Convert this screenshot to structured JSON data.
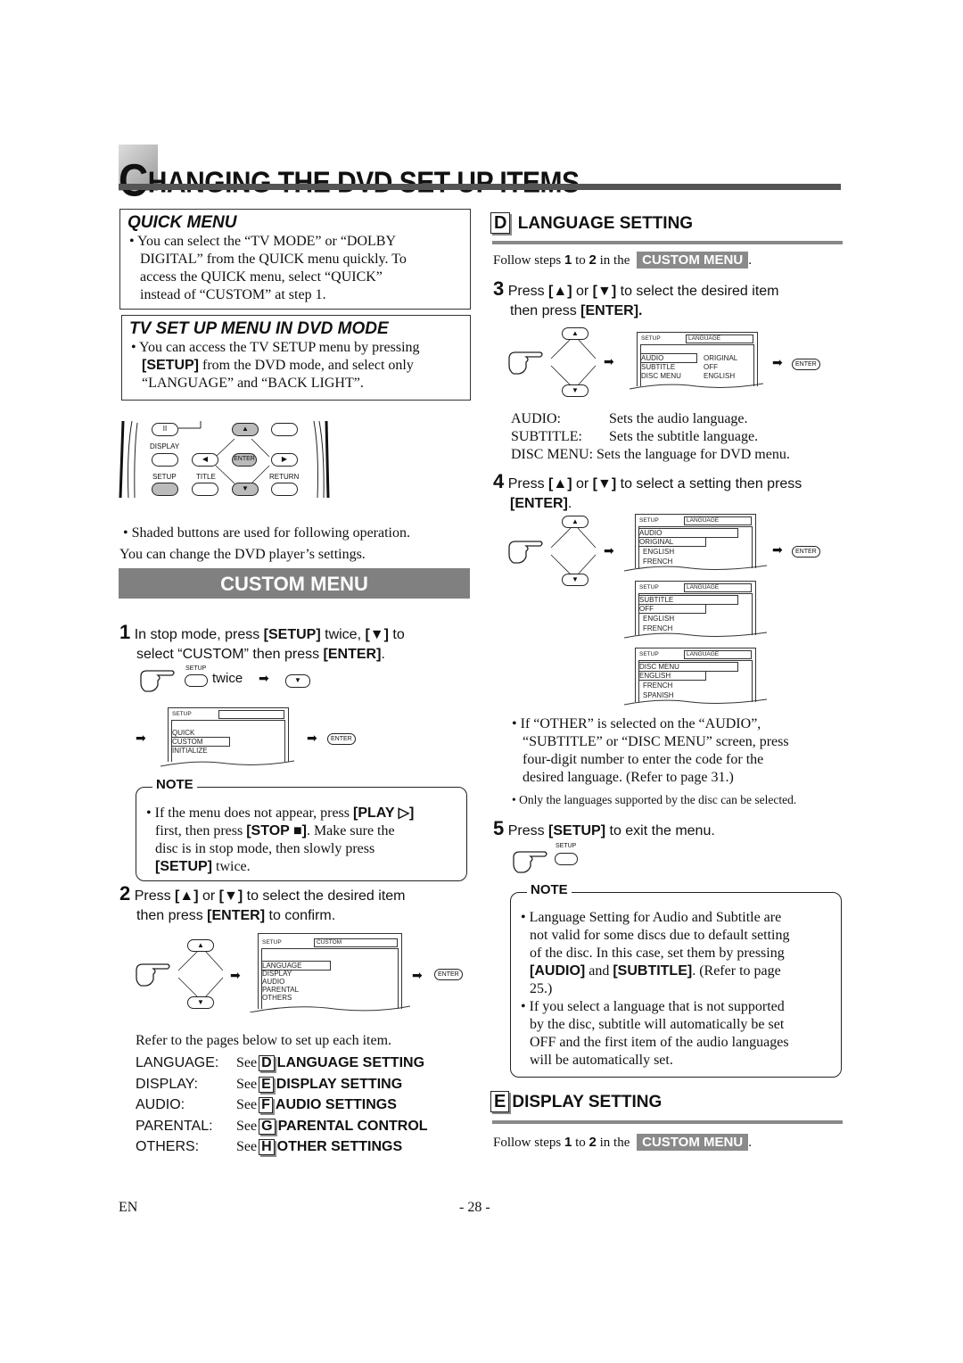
{
  "title": {
    "first_letter": "C",
    "rest": "HANGING THE DVD SET UP ITEMS"
  },
  "quick_menu": {
    "heading": "QUICK MENU",
    "lines": [
      "You can select the “TV MODE” or “DOLBY",
      "DIGITAL” from the QUICK menu quickly. To",
      "access the QUICK menu, select “QUICK”",
      "instead of “CUSTOM” at step 1."
    ]
  },
  "tv_setup": {
    "heading": "TV SET UP MENU IN DVD MODE",
    "line1": "You can access the TV SETUP menu by pressing",
    "line2_bold": "[SETUP]",
    "line2_rest": " from the DVD mode, and select only",
    "line3": "“LANGUAGE” and “BACK LIGHT”."
  },
  "remote": {
    "labels": {
      "display": "DISPLAY",
      "setup": "SETUP",
      "title": "TITLE",
      "return": "RETURN",
      "enter": "ENTER",
      "pause": "II",
      "up": "▲",
      "down": "▼",
      "left": "◀",
      "right": "▶"
    }
  },
  "shaded_note": {
    "line1": "Shaded buttons are used for following operation.",
    "line2": "You can change the DVD player’s settings."
  },
  "custom_menu_banner": "CUSTOM MENU",
  "step1": {
    "num": "1",
    "a": "In stop mode, press ",
    "b": "[SETUP]",
    "c": " twice, ",
    "d": "[▼]",
    "e": " to",
    "f": "select “CUSTOM” then press ",
    "g": "[ENTER]",
    "h": ".",
    "setup_label": "SETUP",
    "twice": "twice",
    "screen": {
      "header": "SETUP",
      "items": [
        "QUICK",
        "CUSTOM",
        "INITIALIZE"
      ],
      "selected": "CUSTOM"
    },
    "enter": "ENTER"
  },
  "note1": {
    "label": "NOTE",
    "a": "If the menu does not appear, press ",
    "b": "[PLAY ▷]",
    "c": "first, then press ",
    "d": "[STOP ■]",
    "e": ". Make sure the",
    "f": "disc is in stop mode, then slowly press",
    "g": "[SETUP]",
    "h": " twice."
  },
  "step2": {
    "num": "2",
    "a": "Press ",
    "b": "[▲]",
    "c": " or ",
    "d": "[▼]",
    "e": " to select the desired item",
    "f": "then press ",
    "g": "[ENTER]",
    "h": " to confirm.",
    "screen": {
      "header": "SETUP",
      "header_value": "CUSTOM",
      "items": [
        "LANGUAGE",
        "DISPLAY",
        "AUDIO",
        "PARENTAL",
        "OTHERS"
      ],
      "selected": "LANGUAGE"
    },
    "enter": "ENTER"
  },
  "refer": {
    "intro": "Refer to the pages below to set up each item.",
    "see": "See",
    "rows": [
      {
        "key": "LANGUAGE:",
        "letter": "D",
        "target": "LANGUAGE SETTING"
      },
      {
        "key": "DISPLAY:",
        "letter": "E",
        "target": "DISPLAY SETTING"
      },
      {
        "key": "AUDIO:",
        "letter": "F",
        "target": "AUDIO SETTINGS"
      },
      {
        "key": "PARENTAL:",
        "letter": "G",
        "target": "PARENTAL CONTROL"
      },
      {
        "key": "OTHERS:",
        "letter": "H",
        "target": "OTHER SETTINGS"
      }
    ]
  },
  "section_d": {
    "letter": "D",
    "heading": "LANGUAGE SETTING",
    "follow": {
      "a": "Follow steps ",
      "s1": "1",
      "to": " to ",
      "s2": "2",
      "in": " in the ",
      "tag": "CUSTOM MENU",
      "end": "."
    },
    "step3": {
      "num": "3",
      "a": "Press ",
      "b": "[▲]",
      "c": " or ",
      "d": "[▼]",
      "e": " to select the desired item",
      "f": "then press ",
      "g": "[ENTER]."
    },
    "screen": {
      "header": "SETUP",
      "header_value": "LANGUAGE",
      "rows": [
        [
          "AUDIO",
          "ORIGINAL"
        ],
        [
          "SUBTITLE",
          "OFF"
        ],
        [
          "DISC MENU",
          "ENGLISH"
        ]
      ],
      "selected": "AUDIO"
    },
    "enter": "ENTER",
    "defs": [
      {
        "k": "AUDIO:",
        "v": "Sets the audio language."
      },
      {
        "k": "SUBTITLE:",
        "v": "Sets the subtitle language."
      },
      {
        "k": "DISC MENU:",
        "v": "Sets the language for DVD menu."
      }
    ],
    "step4": {
      "num": "4",
      "a": "Press ",
      "b": "[▲]",
      "c": " or ",
      "d": "[▼]",
      "e": " to select a setting then press",
      "f": "[ENTER]",
      "g": "."
    },
    "sub_screens": [
      {
        "header": "SETUP",
        "header_value": "LANGUAGE",
        "title": "AUDIO",
        "items": [
          "ORIGINAL",
          "ENGLISH",
          "FRENCH"
        ]
      },
      {
        "header": "SETUP",
        "header_value": "LANGUAGE",
        "title": "SUBTITLE",
        "items": [
          "OFF",
          "ENGLISH",
          "FRENCH"
        ]
      },
      {
        "header": "SETUP",
        "header_value": "LANGUAGE",
        "title": "DISC MENU",
        "items": [
          "ENGLISH",
          "FRENCH",
          "SPANISH"
        ]
      }
    ],
    "other_note": [
      "If “OTHER” is selected on the “AUDIO”,",
      "“SUBTITLE” or “DISC MENU” screen, press",
      "four-digit number to enter the code for the",
      "desired language. (Refer to page 31.)"
    ],
    "only_note": "Only the languages supported by the disc can be selected.",
    "step5": {
      "num": "5",
      "a": "Press ",
      "b": "[SETUP]",
      "c": " to exit the menu.",
      "setup_label": "SETUP"
    }
  },
  "note2": {
    "label": "NOTE",
    "b1": [
      "Language Setting for Audio and Subtitle are",
      "not valid for some discs due to default setting",
      "of the disc. In this case, set them by pressing"
    ],
    "b1_bold1": "[AUDIO]",
    "b1_and": " and ",
    "b1_bold2": "[SUBTITLE]",
    "b1_rest": ". (Refer to page",
    "b1_last": "25.)",
    "b2": [
      "If you select a language that is not supported",
      "by the disc, subtitle will automatically be set",
      "OFF and the first item of the audio languages",
      "will be automatically set."
    ]
  },
  "section_e": {
    "letter": "E",
    "heading": "DISPLAY SETTING",
    "follow": {
      "a": "Follow steps ",
      "s1": "1",
      "to": " to ",
      "s2": "2",
      "in": " in the ",
      "tag": "CUSTOM MENU",
      "end": "."
    }
  },
  "footer": {
    "lang": "EN",
    "page": "- 28 -"
  }
}
